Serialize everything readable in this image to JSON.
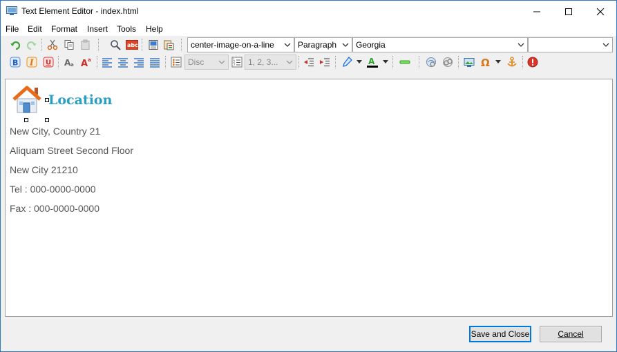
{
  "window": {
    "title": "Text Element Editor - index.html",
    "controls": {
      "minimize": "minimize",
      "maximize": "maximize",
      "close": "close"
    }
  },
  "menu": {
    "items": [
      "File",
      "Edit",
      "Format",
      "Insert",
      "Tools",
      "Help"
    ]
  },
  "toolbar": {
    "row1": {
      "buttons": [
        "undo-icon",
        "redo-icon",
        "cut-icon",
        "copy-icon",
        "paste-icon",
        "find-icon",
        "spellcheck-icon",
        "select-all-icon",
        "paste-special-icon"
      ],
      "style_select": "center-image-on-a-line",
      "block_select": "Paragraph",
      "font_select": "Georgia",
      "size_select": ""
    },
    "row2": {
      "buttons": [
        "bold-icon",
        "italic-icon",
        "underline-icon",
        "font-size-decrease-icon",
        "font-size-increase-icon",
        "align-left-icon",
        "align-center-icon",
        "align-right-icon",
        "justify-icon",
        "bullet-list-icon",
        "numbered-list-icon",
        "outdent-icon",
        "indent-icon",
        "highlight-icon",
        "font-color-icon",
        "horizontal-rule-icon",
        "link-icon",
        "unlink-icon",
        "image-icon",
        "special-char-icon",
        "anchor-icon",
        "help-icon"
      ],
      "bullet_style": "Disc",
      "number_style": "1, 2, 3...",
      "colors": {
        "highlight": "#1e6fd9",
        "font_color": "#000000",
        "hr_accent": "#2fa52f"
      }
    }
  },
  "document": {
    "heading": "Location",
    "lines": [
      "New City, Country 21",
      "Aliquam Street Second Floor",
      "New City 21210",
      "Tel : 000-0000-0000",
      "Fax : 000-0000-0000"
    ],
    "heading_color": "#2a9fc4",
    "image_icon": "house-icon"
  },
  "footer": {
    "save_label": "Save and Close",
    "cancel_label": "Cancel"
  }
}
